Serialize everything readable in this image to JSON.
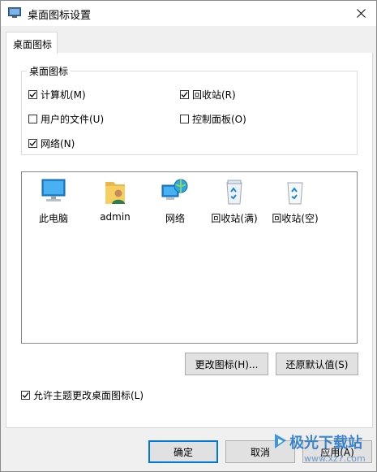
{
  "window": {
    "title": "桌面图标设置"
  },
  "tabs": [
    {
      "label": "桌面图标"
    }
  ],
  "group": {
    "title": "桌面图标",
    "checkboxes": [
      {
        "label": "计算机(M)",
        "checked": true
      },
      {
        "label": "回收站(R)",
        "checked": true
      },
      {
        "label": "用户的文件(U)",
        "checked": false
      },
      {
        "label": "控制面板(O)",
        "checked": false
      },
      {
        "label": "网络(N)",
        "checked": true
      }
    ]
  },
  "icons": [
    {
      "label": "此电脑",
      "icon": "computer-icon"
    },
    {
      "label": "admin",
      "icon": "user-folder-icon"
    },
    {
      "label": "网络",
      "icon": "network-icon"
    },
    {
      "label": "回收站(满)",
      "icon": "recycle-bin-full-icon"
    },
    {
      "label": "回收站(空)",
      "icon": "recycle-bin-empty-icon"
    }
  ],
  "buttons": {
    "change_icon": "更改图标(H)...",
    "restore_default": "还原默认值(S)",
    "ok": "确定",
    "cancel": "取消",
    "apply": "应用(A)"
  },
  "allow_themes": {
    "label": "允许主题更改桌面图标(L)",
    "checked": true
  },
  "watermark": {
    "text": "极光下载站",
    "url": "www.xz7.com"
  },
  "colors": {
    "accent": "#0078d7",
    "checkmark": "#000000"
  }
}
